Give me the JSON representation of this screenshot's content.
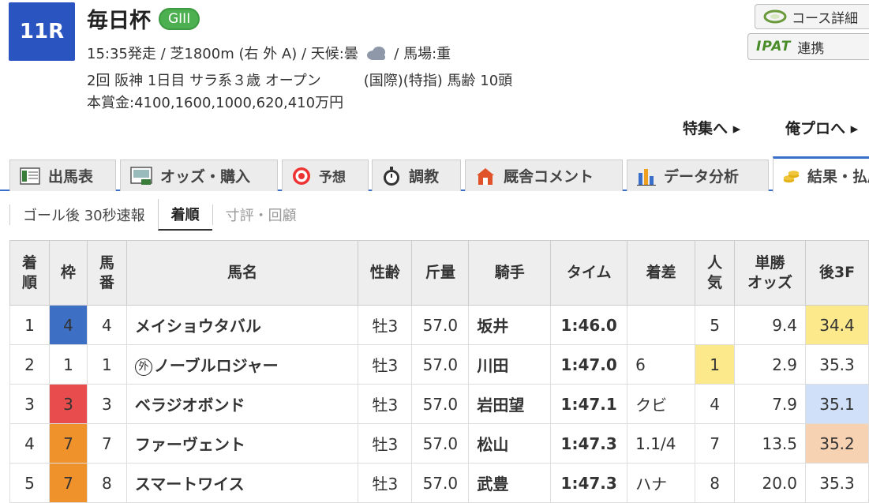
{
  "race": {
    "number": "11R",
    "name": "毎日杯",
    "grade": "GIII",
    "line1_prefix": "15:35発走 / 芝1800m (右 外 A) / 天候:曇",
    "line1_suffix": "/ 馬場:重",
    "line2_left": "2回 阪神 1日目 サラ系３歳 オープン",
    "line2_right": "(国際)(特指) 馬齢 10頭",
    "line3": "本賞金:4100,1600,1000,620,410万円"
  },
  "buttons": {
    "course": "コース詳細",
    "ipat_logo": "IPAT",
    "ipat_label": "連携"
  },
  "links": {
    "special": "特集へ ▸",
    "ore_pro": "俺プロへ ▸"
  },
  "tabs": [
    {
      "label": "出馬表"
    },
    {
      "label": "オッズ・購入"
    },
    {
      "label": "予想"
    },
    {
      "label": "調教"
    },
    {
      "label": "厩舎コメント"
    },
    {
      "label": "データ分析"
    },
    {
      "label": "結果・払戻"
    }
  ],
  "subtabs": [
    {
      "label": "ゴール後 30秒速報"
    },
    {
      "label": "着順"
    },
    {
      "label": "寸評・回顧"
    }
  ],
  "table": {
    "headers": [
      "着\n順",
      "枠",
      "馬\n番",
      "馬名",
      "性齢",
      "斤量",
      "騎手",
      "タイム",
      "着差",
      "人\n気",
      "単勝\nオッズ",
      "後3F"
    ],
    "rows": [
      {
        "pos": "1",
        "waku": "4",
        "num": "4",
        "horse": "メイショウタバル",
        "sexage": "牡3",
        "weight": "57.0",
        "jockey": "坂井",
        "time": "1:46.0",
        "margin": "",
        "pop": "5",
        "odds": "9.4",
        "last3f": "34.4"
      },
      {
        "pos": "2",
        "waku": "1",
        "num": "1",
        "horse": "ノーブルロジャー",
        "foreign": "外",
        "sexage": "牡3",
        "weight": "57.0",
        "jockey": "川田",
        "time": "1:47.0",
        "margin": "6",
        "pop": "1",
        "odds": "2.9",
        "last3f": "35.3"
      },
      {
        "pos": "3",
        "waku": "3",
        "num": "3",
        "horse": "ベラジオボンド",
        "sexage": "牡3",
        "weight": "57.0",
        "jockey": "岩田望",
        "time": "1:47.1",
        "margin": "クビ",
        "pop": "4",
        "odds": "7.9",
        "last3f": "35.1"
      },
      {
        "pos": "4",
        "waku": "7",
        "num": "7",
        "horse": "ファーヴェント",
        "sexage": "牡3",
        "weight": "57.0",
        "jockey": "松山",
        "time": "1:47.3",
        "margin": "1.1/4",
        "pop": "7",
        "odds": "13.5",
        "last3f": "35.2"
      },
      {
        "pos": "5",
        "waku": "7",
        "num": "8",
        "horse": "スマートワイス",
        "sexage": "牡3",
        "weight": "57.0",
        "jockey": "武豊",
        "time": "1:47.3",
        "margin": "ハナ",
        "pop": "8",
        "odds": "20.0",
        "last3f": "35.3"
      }
    ]
  },
  "colors": {
    "waku_1": "#ffffff",
    "waku_3": "#e84c4c",
    "waku_4": "#3d6fc4",
    "waku_7": "#f0922c",
    "pop_highlight": "#fbe98c",
    "last3f_best": "#fbe98c",
    "last3f_second": "#cfe0f8",
    "last3f_third": "#f6d2b2"
  }
}
